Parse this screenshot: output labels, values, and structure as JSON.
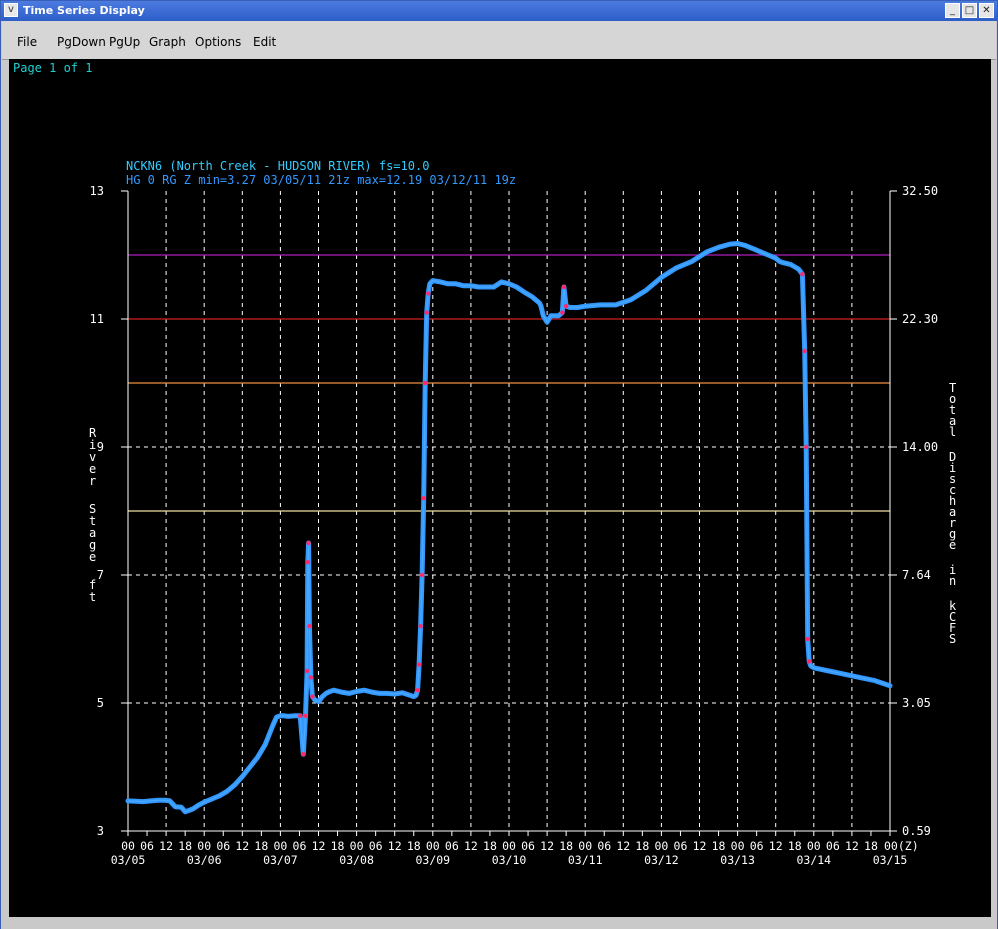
{
  "window": {
    "title": "Time Series Display",
    "sysmenu_glyph": "v",
    "minimize_glyph": "_",
    "maximize_glyph": "□",
    "close_glyph": "✕"
  },
  "menu": {
    "items": [
      "File",
      "PgDown",
      "PgUp",
      "Graph",
      "Options",
      "Edit"
    ]
  },
  "page_indicator": "Page 1 of 1",
  "chart_data": {
    "type": "line",
    "title": "NCKN6 (North Creek - HUDSON RIVER) fs=10.0",
    "subtitle": "HG 0 RG Z min=3.27 03/05/11 21z max=12.19 03/12/11 19z",
    "ylabel": "River Stage ft",
    "y2label": "Total Discharge in kCFS",
    "ylim": [
      3,
      13
    ],
    "y_ticks": [
      "3",
      "5",
      "7",
      "9",
      "11",
      "13"
    ],
    "y2_ticks": [
      "0.59",
      "3.05",
      "7.64",
      "14.00",
      "22.30",
      "32.50"
    ],
    "xlim_days": [
      0,
      10
    ],
    "hour_ticks": [
      "00",
      "06",
      "12",
      "18"
    ],
    "last_hour_tick": "00(Z)",
    "date_ticks": [
      "03/05",
      "03/06",
      "03/07",
      "03/08",
      "03/09",
      "03/10",
      "03/11",
      "03/12",
      "03/13",
      "03/14",
      "03/15"
    ],
    "threshold_lines": [
      {
        "stage": 12,
        "color": "#b01cc0"
      },
      {
        "stage": 11,
        "color": "#d12020"
      },
      {
        "stage": 10,
        "color": "#f09040"
      },
      {
        "stage": 8,
        "color": "#f0e0a0"
      }
    ],
    "series": [
      {
        "color": "#3399ff",
        "marker_color": "#ff2a6a",
        "x_days": [
          0,
          0.2,
          0.3,
          0.4,
          0.5,
          0.55,
          0.62,
          0.7,
          0.75,
          0.82,
          0.86,
          0.92,
          1.0,
          1.1,
          1.2,
          1.3,
          1.4,
          1.5,
          1.6,
          1.7,
          1.8,
          1.85,
          1.9,
          1.95,
          2.0,
          2.05,
          2.1,
          2.2,
          2.26,
          2.3,
          2.33,
          2.35,
          2.36,
          2.37,
          2.38,
          2.4,
          2.42,
          2.45,
          2.5,
          2.55,
          2.6,
          2.65,
          2.7,
          2.8,
          2.9,
          3.0,
          3.1,
          3.2,
          3.3,
          3.4,
          3.5,
          3.6,
          3.7,
          3.75,
          3.78,
          3.8,
          3.82,
          3.84,
          3.86,
          3.88,
          3.9,
          3.92,
          3.94,
          3.96,
          4.0,
          4.1,
          4.2,
          4.3,
          4.4,
          4.5,
          4.6,
          4.7,
          4.8,
          4.9,
          5.0,
          5.1,
          5.2,
          5.3,
          5.35,
          5.4,
          5.42,
          5.45,
          5.5,
          5.55,
          5.6,
          5.65,
          5.7,
          5.72,
          5.75,
          5.8,
          5.9,
          6.0,
          6.2,
          6.4,
          6.6,
          6.8,
          7.0,
          7.2,
          7.4,
          7.6,
          7.75,
          7.9,
          8.0,
          8.1,
          8.2,
          8.3,
          8.4,
          8.5,
          8.55,
          8.6,
          8.7,
          8.8,
          8.85,
          8.88,
          8.9,
          8.92,
          8.94,
          8.96,
          9.0,
          9.2,
          9.4,
          9.6,
          9.8,
          10.0
        ],
        "values": [
          3.47,
          3.46,
          3.47,
          3.48,
          3.48,
          3.47,
          3.38,
          3.37,
          3.3,
          3.33,
          3.35,
          3.4,
          3.45,
          3.5,
          3.55,
          3.62,
          3.72,
          3.85,
          4.0,
          4.15,
          4.35,
          4.5,
          4.65,
          4.78,
          4.8,
          4.8,
          4.79,
          4.8,
          4.8,
          4.2,
          4.8,
          5.5,
          7.2,
          7.5,
          6.2,
          5.4,
          5.1,
          5.05,
          5.02,
          5.1,
          5.15,
          5.18,
          5.2,
          5.17,
          5.15,
          5.18,
          5.2,
          5.17,
          5.15,
          5.15,
          5.14,
          5.16,
          5.12,
          5.1,
          5.12,
          5.2,
          5.6,
          6.2,
          7.0,
          8.2,
          10.0,
          11.1,
          11.4,
          11.55,
          11.6,
          11.58,
          11.55,
          11.55,
          11.52,
          11.52,
          11.5,
          11.5,
          11.5,
          11.58,
          11.55,
          11.5,
          11.42,
          11.35,
          11.3,
          11.25,
          11.2,
          11.05,
          10.95,
          11.05,
          11.05,
          11.05,
          11.1,
          11.5,
          11.2,
          11.18,
          11.18,
          11.2,
          11.22,
          11.22,
          11.3,
          11.45,
          11.65,
          11.8,
          11.9,
          12.05,
          12.12,
          12.17,
          12.18,
          12.15,
          12.1,
          12.05,
          12.0,
          11.95,
          11.9,
          11.88,
          11.85,
          11.78,
          11.7,
          10.5,
          9.0,
          6.0,
          5.65,
          5.58,
          5.55,
          5.5,
          5.45,
          5.4,
          5.35,
          5.27
        ]
      }
    ]
  }
}
